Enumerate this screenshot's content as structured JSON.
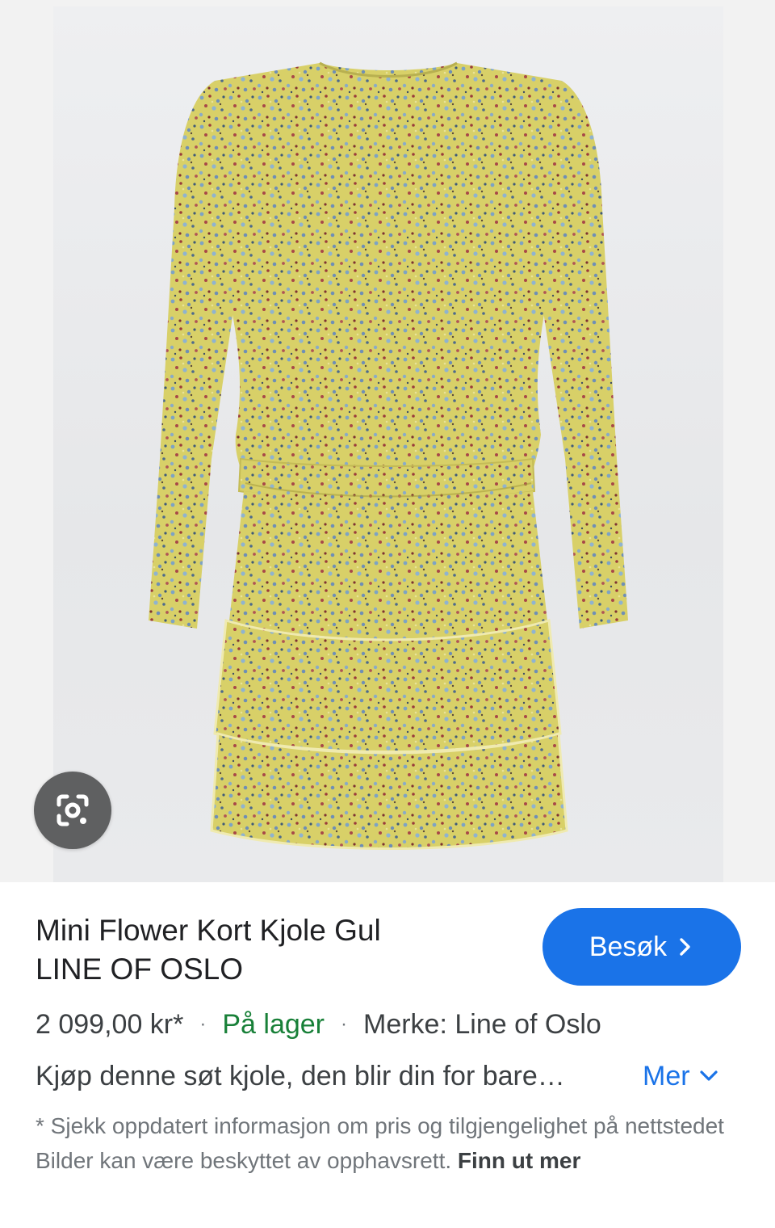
{
  "image_panel": {
    "lens_icon": "google-lens-camera-icon",
    "background_color": "#f2f2f2",
    "dress_color": "#d7cf66"
  },
  "product": {
    "title_line1": "Mini Flower Kort Kjole Gul",
    "title_line2": "LINE OF OSLO",
    "price": "2 099,00 kr*",
    "stock": "På lager",
    "brand": "Merke: Line of Oslo",
    "separator": "·",
    "description": "Kjøp denne søt kjole, den blir din for bare…",
    "more_label": "Mer"
  },
  "visit_button": {
    "label": "Besøk",
    "icon": "chevron-right-icon",
    "color": "#1a73e8"
  },
  "disclaimer": {
    "text": "* Sjekk oppdatert informasjon om pris og tilgjengelighet på nettstedet Bilder kan være beskyttet av opphavsrett. ",
    "link": "Finn ut mer"
  },
  "colors": {
    "stock_green": "#188038",
    "link_blue": "#1a73e8"
  }
}
